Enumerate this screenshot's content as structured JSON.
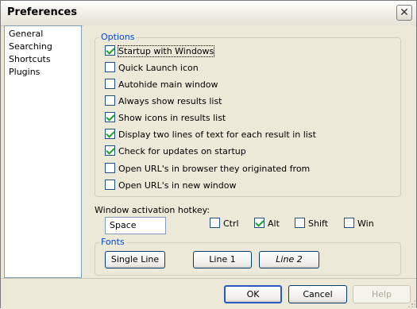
{
  "window": {
    "title": "Preferences",
    "close_glyph": "✕"
  },
  "sidebar": {
    "items": [
      {
        "label": "General"
      },
      {
        "label": "Searching"
      },
      {
        "label": "Shortcuts"
      },
      {
        "label": "Plugins"
      }
    ]
  },
  "options": {
    "legend": "Options",
    "items": [
      {
        "label": "Startup with Windows",
        "checked": true
      },
      {
        "label": "Quick Launch icon",
        "checked": false
      },
      {
        "label": "Autohide main window",
        "checked": false
      },
      {
        "label": "Always show results list",
        "checked": false
      },
      {
        "label": "Show icons in results list",
        "checked": true
      },
      {
        "label": "Display two lines of text for each result in list",
        "checked": true
      },
      {
        "label": "Check for updates on startup",
        "checked": true
      },
      {
        "label": "Open URL's in browser they originated from",
        "checked": false
      },
      {
        "label": "Open URL's in new window",
        "checked": false
      }
    ]
  },
  "hotkey": {
    "label": "Window activation hotkey:",
    "value": "Space",
    "modifiers": [
      {
        "label": "Ctrl",
        "checked": false
      },
      {
        "label": "Alt",
        "checked": true
      },
      {
        "label": "Shift",
        "checked": false
      },
      {
        "label": "Win",
        "checked": false
      }
    ]
  },
  "fonts": {
    "legend": "Fonts",
    "buttons": [
      {
        "label": "Single Line"
      },
      {
        "label": "Line 1"
      },
      {
        "label": "Line 2",
        "italic": true
      }
    ]
  },
  "dialog_buttons": {
    "ok": "OK",
    "cancel": "Cancel",
    "help": "Help"
  },
  "colors": {
    "group_legend": "#0046d5",
    "checkmark": "#21a121",
    "default_button_border": "#2b58c9",
    "window_background": "#ece9d8"
  }
}
